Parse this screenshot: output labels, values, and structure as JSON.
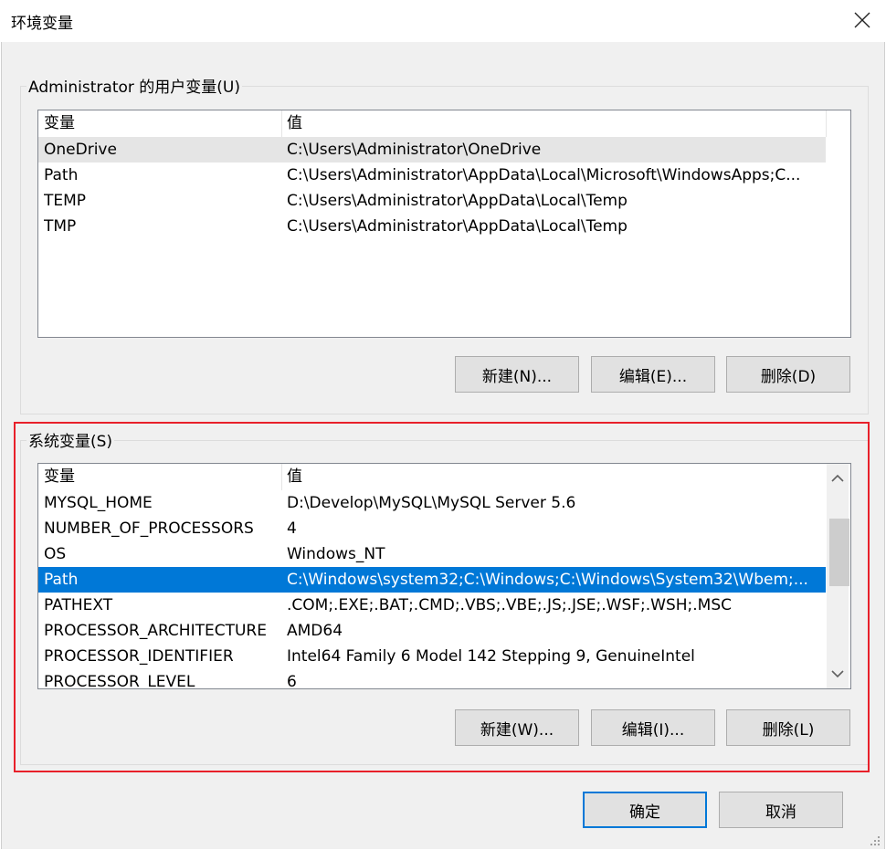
{
  "window": {
    "title": "环境变量",
    "close_icon": "close-icon"
  },
  "user_vars": {
    "group_label": "Administrator 的用户变量(U)",
    "col_var": "变量",
    "col_val": "值",
    "rows": [
      {
        "name": "OneDrive",
        "value": "C:\\Users\\Administrator\\OneDrive"
      },
      {
        "name": "Path",
        "value": "C:\\Users\\Administrator\\AppData\\Local\\Microsoft\\WindowsApps;C..."
      },
      {
        "name": "TEMP",
        "value": "C:\\Users\\Administrator\\AppData\\Local\\Temp"
      },
      {
        "name": "TMP",
        "value": "C:\\Users\\Administrator\\AppData\\Local\\Temp"
      }
    ],
    "btn_new": "新建(N)...",
    "btn_edit": "编辑(E)...",
    "btn_delete": "删除(D)"
  },
  "sys_vars": {
    "group_label": "系统变量(S)",
    "col_var": "变量",
    "col_val": "值",
    "rows": [
      {
        "name": "MYSQL_HOME",
        "value": "D:\\Develop\\MySQL\\MySQL Server 5.6"
      },
      {
        "name": "NUMBER_OF_PROCESSORS",
        "value": "4"
      },
      {
        "name": "OS",
        "value": "Windows_NT"
      },
      {
        "name": "Path",
        "value": "C:\\Windows\\system32;C:\\Windows;C:\\Windows\\System32\\Wbem;..."
      },
      {
        "name": "PATHEXT",
        "value": ".COM;.EXE;.BAT;.CMD;.VBS;.VBE;.JS;.JSE;.WSF;.WSH;.MSC"
      },
      {
        "name": "PROCESSOR_ARCHITECTURE",
        "value": "AMD64"
      },
      {
        "name": "PROCESSOR_IDENTIFIER",
        "value": "Intel64 Family 6 Model 142 Stepping 9, GenuineIntel"
      },
      {
        "name": "PROCESSOR_LEVEL",
        "value": "6"
      }
    ],
    "selected_row": "Path",
    "btn_new": "新建(W)...",
    "btn_edit": "编辑(I)...",
    "btn_delete": "删除(L)"
  },
  "footer": {
    "ok": "确定",
    "cancel": "取消"
  },
  "colors": {
    "selection": "#0078d7",
    "highlight_border": "#e8202a"
  }
}
